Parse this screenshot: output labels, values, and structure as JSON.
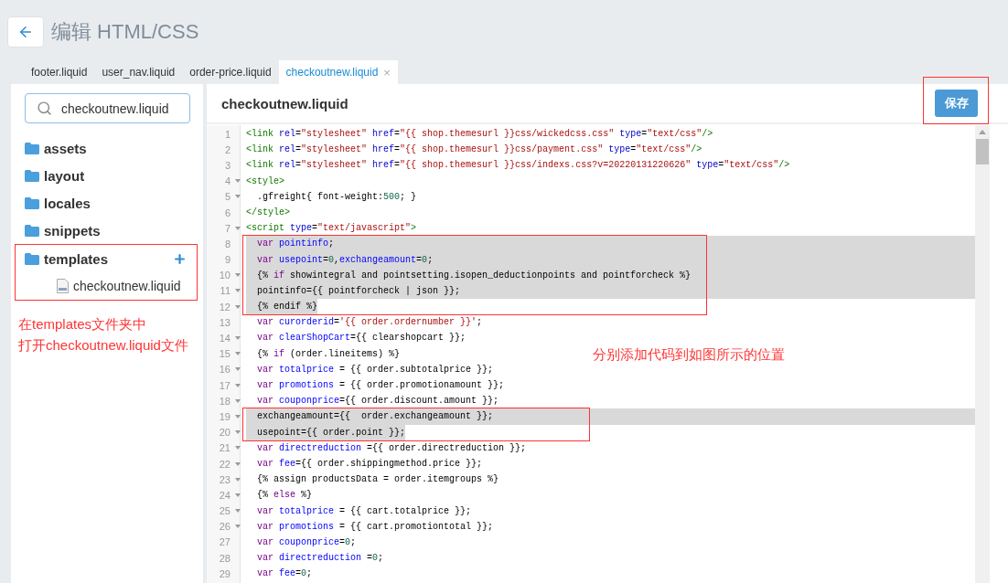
{
  "header": {
    "title": "编辑 HTML/CSS"
  },
  "tabs": [
    {
      "label": "footer.liquid",
      "selected": false
    },
    {
      "label": "user_nav.liquid",
      "selected": false
    },
    {
      "label": "order-price.liquid",
      "selected": false
    },
    {
      "label": "checkoutnew.liquid",
      "selected": true,
      "close": "×"
    }
  ],
  "sidebar": {
    "search": {
      "value": "checkoutnew.liquid"
    },
    "folders": [
      {
        "name": "assets",
        "expanded": false
      },
      {
        "name": "layout",
        "expanded": false
      },
      {
        "name": "locales",
        "expanded": false
      },
      {
        "name": "snippets",
        "expanded": false
      },
      {
        "name": "templates",
        "expanded": true,
        "boxed": true,
        "children": [
          {
            "name": "checkoutnew.liquid"
          }
        ]
      }
    ],
    "note": [
      "在templates文件夹中",
      "打开checkoutnew.liquid文件"
    ]
  },
  "editor": {
    "title": "checkoutnew.liquid",
    "save_button": {
      "label": "保存",
      "boxed": true
    },
    "note": "分别添加代码到如图所示的位置",
    "lines": [
      {
        "n": "1",
        "tokens": [
          {
            "kind": "tag",
            "text": "<link"
          },
          {
            "kind": "attr",
            "text": " rel"
          },
          {
            "kind": "plain",
            "text": "="
          },
          {
            "kind": "str",
            "text": "\"stylesheet\""
          },
          {
            "kind": "attr",
            "text": " href"
          },
          {
            "kind": "plain",
            "text": "="
          },
          {
            "kind": "str",
            "text": "\"{{ shop.themesurl }}css/wickedcss.css\""
          },
          {
            "kind": "attr",
            "text": " type"
          },
          {
            "kind": "plain",
            "text": "="
          },
          {
            "kind": "str",
            "text": "\"text/css\""
          },
          {
            "kind": "tag",
            "text": "/>"
          }
        ]
      },
      {
        "n": "2",
        "tokens": [
          {
            "kind": "tag",
            "text": "<link"
          },
          {
            "kind": "attr",
            "text": " rel"
          },
          {
            "kind": "plain",
            "text": "="
          },
          {
            "kind": "str",
            "text": "\"stylesheet\""
          },
          {
            "kind": "attr",
            "text": " href"
          },
          {
            "kind": "plain",
            "text": "="
          },
          {
            "kind": "str",
            "text": "\"{{ shop.themesurl }}css/payment.css\""
          },
          {
            "kind": "attr",
            "text": " type"
          },
          {
            "kind": "plain",
            "text": "="
          },
          {
            "kind": "str",
            "text": "\"text/css\""
          },
          {
            "kind": "tag",
            "text": "/>"
          }
        ]
      },
      {
        "n": "3",
        "tokens": [
          {
            "kind": "tag",
            "text": "<link"
          },
          {
            "kind": "attr",
            "text": " rel"
          },
          {
            "kind": "plain",
            "text": "="
          },
          {
            "kind": "str",
            "text": "\"stylesheet\""
          },
          {
            "kind": "attr",
            "text": " href"
          },
          {
            "kind": "plain",
            "text": "="
          },
          {
            "kind": "str",
            "text": "\"{{ shop.themesurl }}css/indexs.css?v=20220131220626\""
          },
          {
            "kind": "attr",
            "text": " type"
          },
          {
            "kind": "plain",
            "text": "="
          },
          {
            "kind": "str",
            "text": "\"text/css\""
          },
          {
            "kind": "tag",
            "text": "/>"
          }
        ]
      },
      {
        "n": "4",
        "fold": true,
        "tokens": [
          {
            "kind": "tag",
            "text": "<style>"
          }
        ]
      },
      {
        "n": "5",
        "fold": true,
        "tokens": [
          {
            "kind": "plain",
            "text": "  .gfreight{ font-weight:"
          },
          {
            "kind": "num",
            "text": "500"
          },
          {
            "kind": "plain",
            "text": "; }"
          }
        ]
      },
      {
        "n": "6",
        "tokens": [
          {
            "kind": "tag",
            "text": "</style>"
          }
        ]
      },
      {
        "n": "7",
        "fold": true,
        "tokens": [
          {
            "kind": "tag",
            "text": "<script"
          },
          {
            "kind": "attr",
            "text": " type"
          },
          {
            "kind": "plain",
            "text": "="
          },
          {
            "kind": "str",
            "text": "\"text/javascript\""
          },
          {
            "kind": "tag",
            "text": ">"
          }
        ]
      },
      {
        "n": "8",
        "highlighted": true,
        "boxed": true,
        "tokens": [
          {
            "kind": "kw",
            "text": "  var"
          },
          {
            "kind": "def",
            "text": " pointinfo"
          },
          {
            "kind": "plain",
            "text": ";"
          }
        ]
      },
      {
        "n": "9",
        "highlighted": true,
        "boxed": true,
        "tokens": [
          {
            "kind": "kw",
            "text": "  var"
          },
          {
            "kind": "def",
            "text": " usepoint"
          },
          {
            "kind": "plain",
            "text": "="
          },
          {
            "kind": "num",
            "text": "0"
          },
          {
            "kind": "plain",
            "text": ","
          },
          {
            "kind": "def",
            "text": "exchangeamount"
          },
          {
            "kind": "plain",
            "text": "="
          },
          {
            "kind": "num",
            "text": "0"
          },
          {
            "kind": "plain",
            "text": ";"
          }
        ]
      },
      {
        "n": "10",
        "fold": true,
        "highlighted": true,
        "boxed": true,
        "tokens": [
          {
            "kind": "plain",
            "text": "  {% "
          },
          {
            "kind": "kw",
            "text": "if"
          },
          {
            "kind": "plain",
            "text": " showintegral and pointsetting.isopen_deductionpoints and pointforcheck %}"
          }
        ]
      },
      {
        "n": "11",
        "fold": true,
        "highlighted": true,
        "boxed": true,
        "tokens": [
          {
            "kind": "plain",
            "text": "  pointinfo={{ pointforcheck | json }};"
          }
        ]
      },
      {
        "n": "12",
        "fold": true,
        "partial_highlight": true,
        "boxed": true,
        "tokens": [
          {
            "kind": "plain",
            "text": "  {% endif %}"
          }
        ]
      },
      {
        "n": "13",
        "tokens": [
          {
            "kind": "kw",
            "text": "  var"
          },
          {
            "kind": "def",
            "text": " curorderid"
          },
          {
            "kind": "plain",
            "text": "="
          },
          {
            "kind": "str",
            "text": "'{{ order.ordernumber }}'"
          },
          {
            "kind": "plain",
            "text": ";"
          }
        ]
      },
      {
        "n": "14",
        "fold": true,
        "tokens": [
          {
            "kind": "kw",
            "text": "  var"
          },
          {
            "kind": "def",
            "text": " clearShopCart"
          },
          {
            "kind": "plain",
            "text": "={{ clearshopcart }};"
          }
        ]
      },
      {
        "n": "15",
        "fold": true,
        "tokens": [
          {
            "kind": "plain",
            "text": "  {% "
          },
          {
            "kind": "kw",
            "text": "if"
          },
          {
            "kind": "plain",
            "text": " (order.lineitems) %}"
          }
        ]
      },
      {
        "n": "16",
        "fold": true,
        "tokens": [
          {
            "kind": "kw",
            "text": "  var"
          },
          {
            "kind": "def",
            "text": " totalprice"
          },
          {
            "kind": "plain",
            "text": " = {{ order.subtotalprice }};"
          }
        ]
      },
      {
        "n": "17",
        "fold": true,
        "tokens": [
          {
            "kind": "kw",
            "text": "  var"
          },
          {
            "kind": "def",
            "text": " promotions"
          },
          {
            "kind": "plain",
            "text": " = {{ order.promotionamount }};"
          }
        ]
      },
      {
        "n": "18",
        "fold": true,
        "tokens": [
          {
            "kind": "kw",
            "text": "  var"
          },
          {
            "kind": "def",
            "text": " couponprice"
          },
          {
            "kind": "plain",
            "text": "={{ order.discount.amount }};"
          }
        ]
      },
      {
        "n": "19",
        "fold": true,
        "highlighted": true,
        "boxed": true,
        "tokens": [
          {
            "kind": "plain",
            "text": "  exchangeamount={{  order.exchangeamount }};"
          }
        ]
      },
      {
        "n": "20",
        "fold": true,
        "partial_highlight": true,
        "boxed": true,
        "tokens": [
          {
            "kind": "plain",
            "text": "  usepoint={{ order.point }};"
          }
        ]
      },
      {
        "n": "21",
        "fold": true,
        "tokens": [
          {
            "kind": "kw",
            "text": "  var"
          },
          {
            "kind": "def",
            "text": " directreduction"
          },
          {
            "kind": "plain",
            "text": " ={{ order.directreduction }};"
          }
        ]
      },
      {
        "n": "22",
        "fold": true,
        "tokens": [
          {
            "kind": "kw",
            "text": "  var"
          },
          {
            "kind": "def",
            "text": " fee"
          },
          {
            "kind": "plain",
            "text": "={{ order.shippingmethod.price }};"
          }
        ]
      },
      {
        "n": "23",
        "fold": true,
        "tokens": [
          {
            "kind": "plain",
            "text": "  {% assign productsData = order.itemgroups %}"
          }
        ]
      },
      {
        "n": "24",
        "fold": true,
        "tokens": [
          {
            "kind": "plain",
            "text": "  {% "
          },
          {
            "kind": "kw",
            "text": "else"
          },
          {
            "kind": "plain",
            "text": " %}"
          }
        ]
      },
      {
        "n": "25",
        "fold": true,
        "tokens": [
          {
            "kind": "kw",
            "text": "  var"
          },
          {
            "kind": "def",
            "text": " totalprice"
          },
          {
            "kind": "plain",
            "text": " = {{ cart.totalprice }};"
          }
        ]
      },
      {
        "n": "26",
        "fold": true,
        "tokens": [
          {
            "kind": "kw",
            "text": "  var"
          },
          {
            "kind": "def",
            "text": " promotions"
          },
          {
            "kind": "plain",
            "text": " = {{ cart.promotiontotal }};"
          }
        ]
      },
      {
        "n": "27",
        "tokens": [
          {
            "kind": "kw",
            "text": "  var"
          },
          {
            "kind": "def",
            "text": " couponprice"
          },
          {
            "kind": "plain",
            "text": "="
          },
          {
            "kind": "num",
            "text": "0"
          },
          {
            "kind": "plain",
            "text": ";"
          }
        ]
      },
      {
        "n": "28",
        "tokens": [
          {
            "kind": "kw",
            "text": "  var"
          },
          {
            "kind": "def",
            "text": " directreduction"
          },
          {
            "kind": "plain",
            "text": " ="
          },
          {
            "kind": "num",
            "text": "0"
          },
          {
            "kind": "plain",
            "text": ";"
          }
        ]
      },
      {
        "n": "29",
        "tokens": [
          {
            "kind": "kw",
            "text": "  var"
          },
          {
            "kind": "def",
            "text": " fee"
          },
          {
            "kind": "plain",
            "text": "="
          },
          {
            "kind": "num",
            "text": "0"
          },
          {
            "kind": "plain",
            "text": ";"
          }
        ]
      }
    ]
  }
}
